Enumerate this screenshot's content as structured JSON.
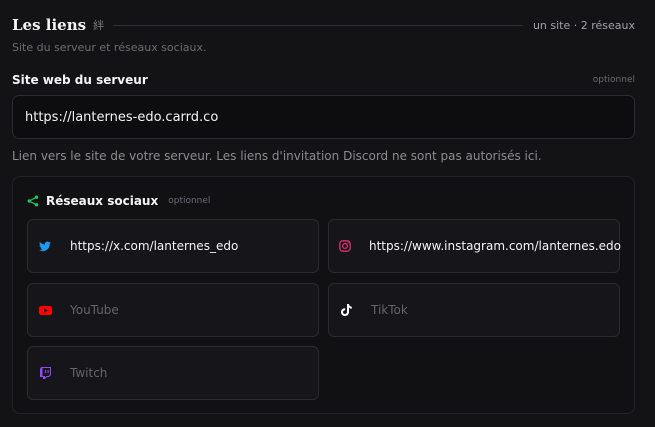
{
  "section": {
    "title": "Les liens",
    "title_kanji": "絆",
    "meta": "un site · 2 réseaux",
    "subtitle": "Site du serveur et réseaux sociaux."
  },
  "website": {
    "label": "Site web du serveur",
    "optional_label": "optionnel",
    "value": "https://lanternes-edo.carrd.co",
    "hint": "Lien vers le site de votre serveur. Les liens d'invitation Discord ne sont pas autorisés ici."
  },
  "socials": {
    "title": "Réseaux sociaux",
    "optional_label": "optionnel",
    "accent_color": "#22c55e",
    "items": [
      {
        "id": "twitter",
        "icon": "twitter-bird-icon",
        "color": "#1d9bf0",
        "value": "https://x.com/lanternes_edo",
        "placeholder": "Twitter"
      },
      {
        "id": "instagram",
        "icon": "instagram-icon",
        "color": "#e1306c",
        "value": "https://www.instagram.com/lanternes.edo",
        "placeholder": "Instagram"
      },
      {
        "id": "youtube",
        "icon": "youtube-icon",
        "color": "#ff0000",
        "value": "",
        "placeholder": "YouTube"
      },
      {
        "id": "tiktok",
        "icon": "tiktok-icon",
        "color": "#ffffff",
        "value": "",
        "placeholder": "TikTok"
      },
      {
        "id": "twitch",
        "icon": "twitch-icon",
        "color": "#9146ff",
        "value": "",
        "placeholder": "Twitch"
      }
    ]
  }
}
